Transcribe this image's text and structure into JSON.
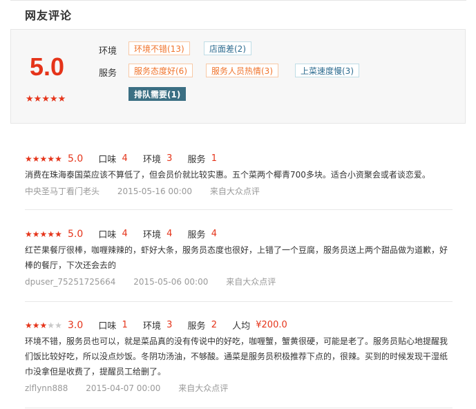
{
  "section": {
    "title": "网友评论"
  },
  "summary": {
    "score": "5.0",
    "stars": 5,
    "rows": [
      {
        "label": "环境",
        "tags": [
          {
            "text": "环境不错(13)",
            "kind": "pos"
          },
          {
            "text": "店面差(2)",
            "kind": "neg"
          }
        ]
      },
      {
        "label": "服务",
        "tags": [
          {
            "text": "服务态度好(6)",
            "kind": "pos"
          },
          {
            "text": "服务人员热情(3)",
            "kind": "pos"
          },
          {
            "text": "上菜速度慢(3)",
            "kind": "neg"
          }
        ]
      },
      {
        "label": "",
        "tags": [
          {
            "text": "排队需要(1)",
            "kind": "hot"
          }
        ]
      }
    ]
  },
  "reviews": [
    {
      "stars": 5,
      "score": "5.0",
      "ratings": [
        {
          "k": "口味",
          "v": "4"
        },
        {
          "k": "环境",
          "v": "3"
        },
        {
          "k": "服务",
          "v": "1"
        }
      ],
      "text": "消费在珠海泰国菜应该不算低了，但会员价就比较实惠。五个菜两个椰青700多块。适合小资聚会或者谈恋爱。",
      "user": "中央圣马丁看门老头",
      "date": "2015-05-16 00:00",
      "source": "来自大众点评"
    },
    {
      "stars": 5,
      "score": "5.0",
      "ratings": [
        {
          "k": "口味",
          "v": "4"
        },
        {
          "k": "环境",
          "v": "4"
        },
        {
          "k": "服务",
          "v": "4"
        }
      ],
      "text": "红芒果餐厅很棒，咖喱辣辣的，虾好大条，服务员态度也很好，上错了一个豆腐，服务员送上两个甜品做为道歉，好棒的餐厅，下次还会去的",
      "user": "dpuser_75251725664",
      "date": "2015-05-06 00:00",
      "source": "来自大众点评"
    },
    {
      "stars": 3,
      "score": "3.0",
      "ratings": [
        {
          "k": "口味",
          "v": "1"
        },
        {
          "k": "环境",
          "v": "3"
        },
        {
          "k": "服务",
          "v": "2"
        },
        {
          "k": "人均",
          "v": "¥200.0"
        }
      ],
      "text": "环境不错，服务员也可以，就是菜品真的没有传说中的好吃，咖喱蟹，蟹黄很硬，可能是老了。服务员贴心地提醒我们饭比较好吃，所以没点炒饭。冬阴功汤油，不够酸。通菜是服务员积极推荐下点的，很辣。买到的时候发现干湿纸巾没拿但是收费了，提醒员工给删了。",
      "user": "zlflynn888",
      "date": "2015-04-07 00:00",
      "source": "来自大众点评"
    }
  ],
  "colors": {
    "accent": "#e5341a",
    "tag_positive": "#f0742c",
    "tag_negative": "#2c6b8f",
    "tag_hot_bg": "#3b6f83"
  }
}
